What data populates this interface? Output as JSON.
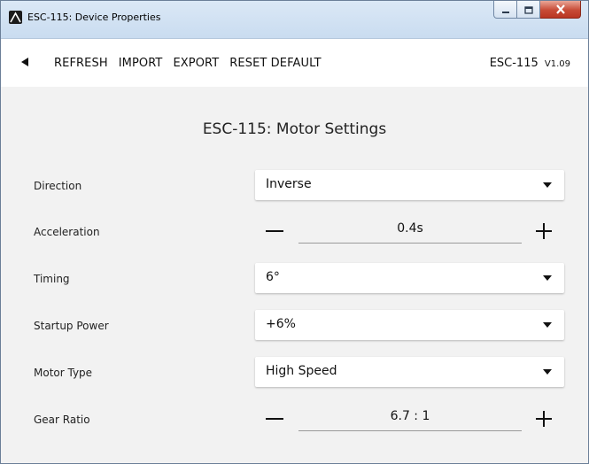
{
  "window": {
    "title": "ESC-115: Device Properties",
    "icon": "mountain-logo-icon",
    "controls": [
      "minimize-icon",
      "maximize-icon",
      "close-icon"
    ]
  },
  "toolbar": {
    "back_icon": "back-arrow-icon",
    "refresh_label": "REFRESH",
    "import_label": "IMPORT",
    "export_label": "EXPORT",
    "reset_label": "RESET DEFAULT",
    "device_name": "ESC-115",
    "device_version": "V1.09"
  },
  "main": {
    "section_title": "ESC-115: Motor Settings",
    "settings": [
      {
        "label": "Direction",
        "control": "select",
        "value": "Inverse"
      },
      {
        "label": "Acceleration",
        "control": "stepper",
        "value": "0.4s"
      },
      {
        "label": "Timing",
        "control": "select",
        "value": "6°"
      },
      {
        "label": "Startup Power",
        "control": "select",
        "value": "+6%"
      },
      {
        "label": "Motor Type",
        "control": "select",
        "value": "High Speed"
      },
      {
        "label": "Gear Ratio",
        "control": "stepper",
        "value": "6.7 : 1"
      }
    ]
  },
  "colors": {
    "titlebar": "#c9dcf0",
    "toolbar_bg": "#ffffff",
    "content_bg": "#f2f2f2",
    "close_button": "#c74b36"
  }
}
